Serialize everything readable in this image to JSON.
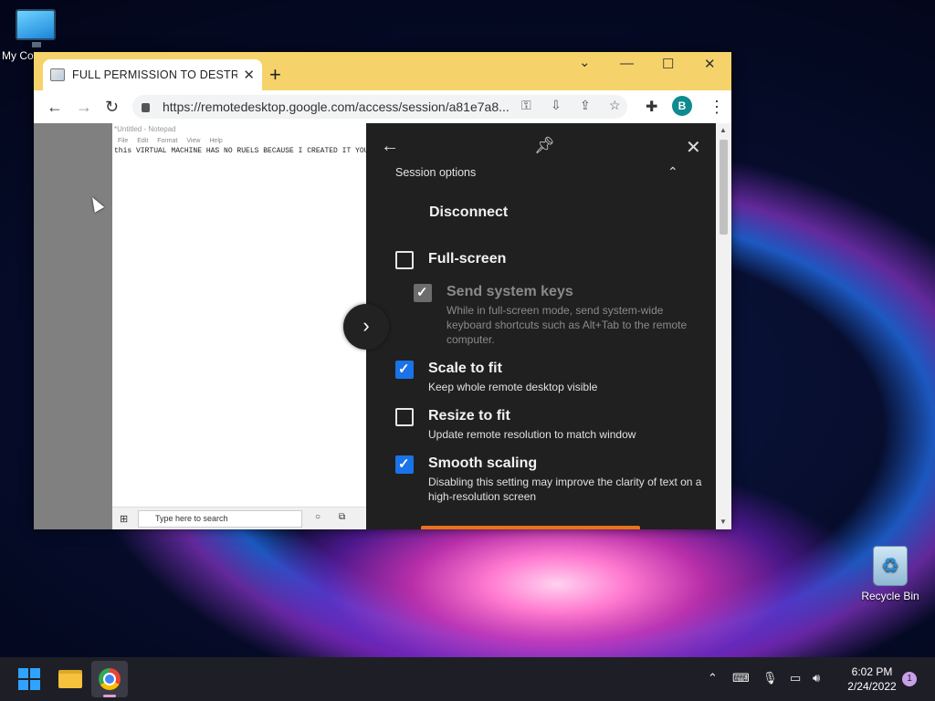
{
  "desktop": {
    "icons": [
      {
        "label": "My Co",
        "icon": "monitor-icon"
      },
      {
        "label": "Recycle Bin",
        "icon": "recycle-bin-icon"
      }
    ]
  },
  "browser": {
    "tab_title": "FULL PERMISSION TO DESTROY",
    "tab_close": "✕",
    "new_tab": "+",
    "win_minimize_chevron": "⌄",
    "win_minimize": "—",
    "win_maximize": "☐",
    "win_close": "✕",
    "url": "https://remotedesktop.google.com/access/session/a81e7a8...",
    "profile_initial": "B",
    "theme_color": "#f6d36a"
  },
  "remote": {
    "notepad_title": "*Untitled - Notepad",
    "notepad_menu": [
      "File",
      "Edit",
      "Format",
      "View",
      "Help"
    ],
    "notepad_text": "this VIRTUAL MACHINE HAS NO RUELS BECAUSE I CREATED IT YOU N",
    "search_placeholder": "Type here to search"
  },
  "panel": {
    "section_title": "Session options",
    "disconnect": "Disconnect",
    "options": [
      {
        "name": "Full-screen",
        "desc": "",
        "checked": false,
        "disabled": false
      },
      {
        "name": "Send system keys",
        "desc": "While in full-screen mode, send system-wide keyboard shortcuts such as Alt+Tab to the remote computer.",
        "checked": true,
        "disabled": true
      },
      {
        "name": "Scale to fit",
        "desc": "Keep whole remote desktop visible",
        "checked": true,
        "disabled": false
      },
      {
        "name": "Resize to fit",
        "desc": "Update remote resolution to match window",
        "checked": false,
        "disabled": false
      },
      {
        "name": "Smooth scaling",
        "desc": "Disabling this setting may improve the clarity of text on a high-resolution screen",
        "checked": true,
        "disabled": false
      }
    ],
    "accent": "#1a73e8"
  },
  "taskbar": {
    "time": "6:02 PM",
    "date": "2/24/2022",
    "notification_count": "1"
  }
}
